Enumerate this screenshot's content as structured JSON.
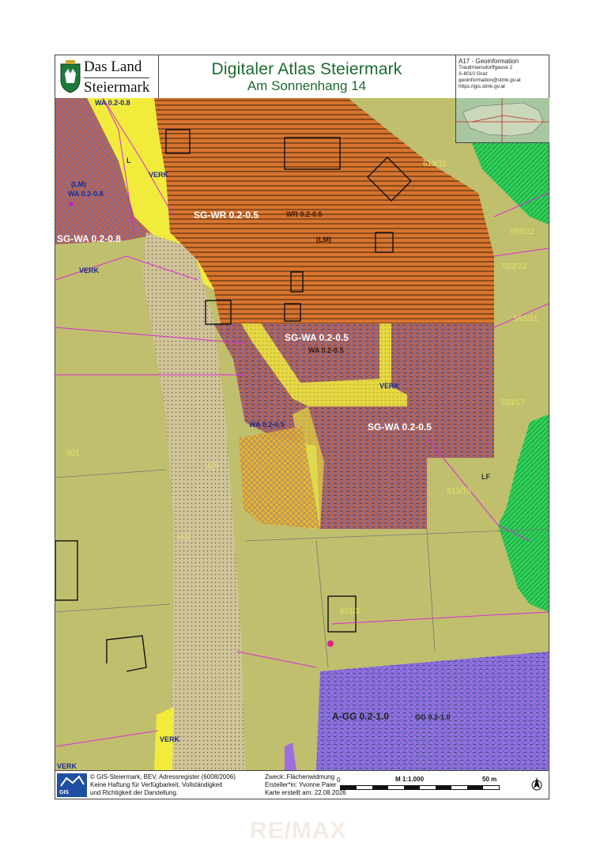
{
  "header": {
    "logo_line1": "Das Land",
    "logo_line2": "Steiermark",
    "title": "Digitaler Atlas Steiermark",
    "subtitle": "Am Sonnenhang 14",
    "dept": "A17 - Geoinformation",
    "address1": "Trauttmansdorffgasse 2",
    "address2": "A-8010 Graz",
    "email": "geoinformation@stmk.gv.at",
    "web": "https://gis.stmk.gv.at"
  },
  "map": {
    "labels": {
      "wa_top": "WA 0.2-0.8",
      "l": "L",
      "verk1": "VERK",
      "lm_left": "(LM)",
      "wa_left": "WA 0.2-0.8",
      "sg_wa_left": "SG-WA 0.2-0.8",
      "verk_left": "VERK",
      "sg_wr": "SG-WR 0.2-0.5",
      "wr": "WR 0.2-0.5",
      "lm_center": "(LM)",
      "p593_22": "593/22",
      "p593_23": "593/23",
      "p593_21": "593/21",
      "p613_1": "613/11",
      "sg_wa_mid": "SG-WA 0.2-0.5",
      "wa_mid": "WA 0.2-0.5",
      "verk_mid": "VERK",
      "p593_17": "593/17",
      "wa_small": "WA 0.2-0.5",
      "sg_wa_low": "SG-WA 0.2-0.5",
      "p601": "601",
      "p326": "326",
      "lf": "LF",
      "p602": "602",
      "p613_2": "613/10",
      "p6213": "621/3",
      "a_gg": "A-GG 0.2-1.0",
      "gg": "GG 0.2-1.0",
      "verk_bottom": "VERK",
      "verk_corner": "VERK"
    }
  },
  "footer": {
    "gis": "GIS",
    "copyright": "© GIS-Steiermark, BEV, Adressregister (6008/2006)",
    "disclaimer1": "Keine Haftung für Verfügbarkeit, Vollständigkeit",
    "disclaimer2": "und Richtigkeit der Darstellung.",
    "purpose": "Zweck: Flächenwidmung",
    "creator": "Ersteller*in: Yvonne Paier",
    "date": "Karte erstellt am: 22.08.2026",
    "scale": "M 1:1.000",
    "scale_unit": "50 m",
    "zero": "0"
  },
  "watermark": "RE/MAX",
  "colors": {
    "residential_pure": "#d9742d",
    "residential_general": "#c9603a",
    "commercial": "#9e6ee0",
    "traffic": "#f1ec3c",
    "agriculture": "#c3c36a",
    "forest": "#2fd15a",
    "title_green": "#1b6b2f"
  }
}
